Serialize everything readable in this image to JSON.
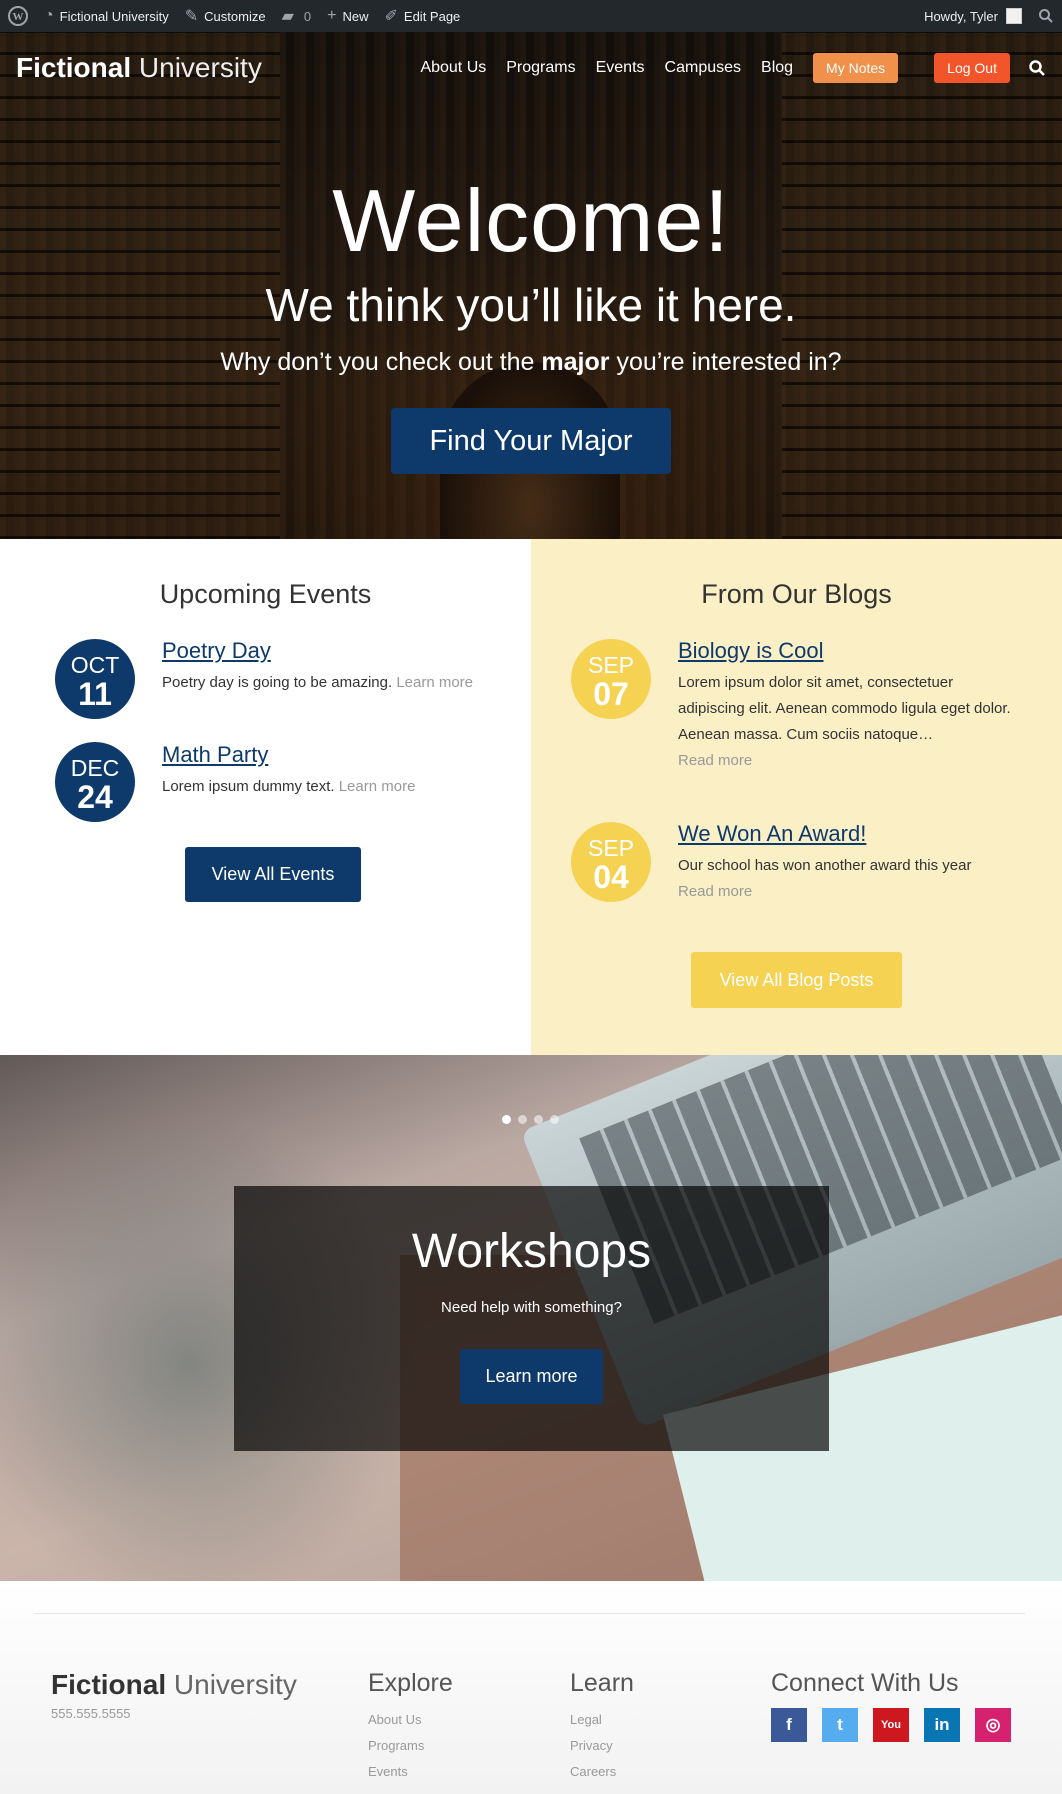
{
  "adminbar": {
    "site_name": "Fictional University",
    "customize": "Customize",
    "comments_count": "0",
    "new": "New",
    "edit_page": "Edit Page",
    "howdy": "Howdy, Tyler"
  },
  "header": {
    "logo_bold": "Fictional",
    "logo_light": "University",
    "nav": [
      "About Us",
      "Programs",
      "Events",
      "Campuses",
      "Blog"
    ],
    "my_notes": "My Notes",
    "log_out": "Log Out"
  },
  "hero": {
    "title": "Welcome!",
    "subtitle": "We think you’ll like it here.",
    "prompt_pre": "Why don’t you check out the ",
    "prompt_bold": "major",
    "prompt_post": " you’re interested in?",
    "cta": "Find Your Major"
  },
  "events": {
    "title": "Upcoming Events",
    "items": [
      {
        "month": "OCT",
        "day": "11",
        "title": "Poetry Day",
        "excerpt": "Poetry day is going to be amazing. ",
        "more": "Learn more"
      },
      {
        "month": "DEC",
        "day": "24",
        "title": "Math Party",
        "excerpt": "Lorem ipsum dummy text. ",
        "more": "Learn more"
      }
    ],
    "view_all": "View All Events"
  },
  "blogs": {
    "title": "From Our Blogs",
    "items": [
      {
        "month": "SEP",
        "day": "07",
        "title": "Biology is Cool",
        "excerpt": "Lorem ipsum dolor sit amet, consectetuer adipiscing elit. Aenean commodo ligula eget dolor. Aenean massa. Cum sociis natoque…",
        "more": "Read more"
      },
      {
        "month": "SEP",
        "day": "04",
        "title": "We Won An Award!",
        "excerpt": "Our school has won another award this year",
        "more": "Read more"
      }
    ],
    "view_all": "View All Blog Posts"
  },
  "slider": {
    "active_slide_index": 0,
    "slide_count": 4,
    "title": "Workshops",
    "subtitle": "Need help with something?",
    "cta": "Learn more"
  },
  "footer": {
    "logo_bold": "Fictional",
    "logo_light": "University",
    "phone": "555.555.5555",
    "explore_title": "Explore",
    "explore_links": [
      "About Us",
      "Programs",
      "Events"
    ],
    "learn_title": "Learn",
    "learn_links": [
      "Legal",
      "Privacy",
      "Careers"
    ],
    "connect_title": "Connect With Us",
    "social": [
      {
        "icon": "facebook-icon",
        "glyph": "f",
        "color": "#3b5998"
      },
      {
        "icon": "twitter-icon",
        "glyph": "t",
        "color": "#55acee"
      },
      {
        "icon": "youtube-icon",
        "glyph": "You",
        "color": "#cc181e"
      },
      {
        "icon": "linkedin-icon",
        "glyph": "in",
        "color": "#0976b4"
      },
      {
        "icon": "instagram-icon",
        "glyph": "◎",
        "color": "#d6226e"
      }
    ]
  },
  "colors": {
    "navy": "#0d3a6b",
    "gold": "#f6d253",
    "blog_bg": "#fbefc6",
    "notes_orange": "#f0904a",
    "logout_red": "#f2552a"
  }
}
